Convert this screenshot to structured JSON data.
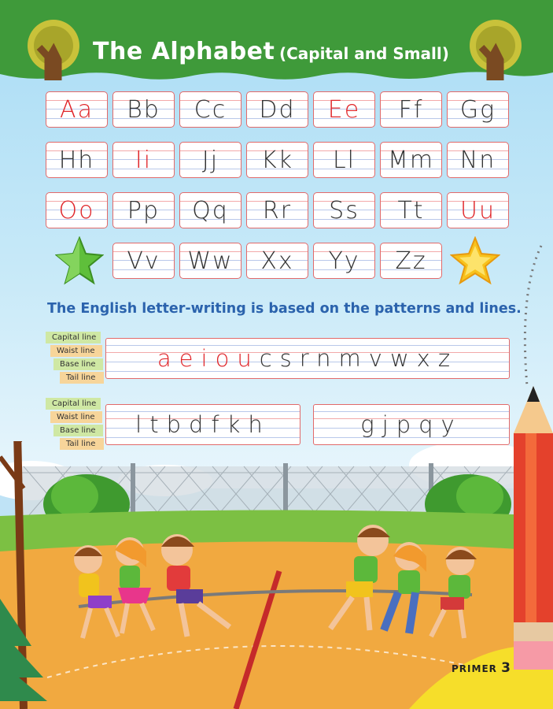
{
  "header": {
    "title": "The Alphabet",
    "subtitle": "(Capital and Small)"
  },
  "alphabet": [
    {
      "pair": "Aa",
      "vowel": true
    },
    {
      "pair": "Bb",
      "vowel": false
    },
    {
      "pair": "Cc",
      "vowel": false
    },
    {
      "pair": "Dd",
      "vowel": false
    },
    {
      "pair": "Ee",
      "vowel": true
    },
    {
      "pair": "Ff",
      "vowel": false
    },
    {
      "pair": "Gg",
      "vowel": false
    },
    {
      "pair": "Hh",
      "vowel": false
    },
    {
      "pair": "Ii",
      "vowel": true
    },
    {
      "pair": "Jj",
      "vowel": false
    },
    {
      "pair": "Kk",
      "vowel": false
    },
    {
      "pair": "Ll",
      "vowel": false
    },
    {
      "pair": "Mm",
      "vowel": false
    },
    {
      "pair": "Nn",
      "vowel": false
    },
    {
      "pair": "Oo",
      "vowel": true
    },
    {
      "pair": "Pp",
      "vowel": false
    },
    {
      "pair": "Qq",
      "vowel": false
    },
    {
      "pair": "Rr",
      "vowel": false
    },
    {
      "pair": "Ss",
      "vowel": false
    },
    {
      "pair": "Tt",
      "vowel": false
    },
    {
      "pair": "Uu",
      "vowel": true
    },
    {
      "pair": "Vv",
      "vowel": false
    },
    {
      "pair": "Ww",
      "vowel": false
    },
    {
      "pair": "Xx",
      "vowel": false
    },
    {
      "pair": "Yy",
      "vowel": false
    },
    {
      "pair": "Zz",
      "vowel": false
    }
  ],
  "note": "The English letter-writing is based on the patterns and lines.",
  "guide_labels": [
    "Capital line",
    "Waist line",
    "Base line",
    "Tail line"
  ],
  "practice": {
    "row1_vowels": "aeiou",
    "row1_rest": "csrnmvwxz",
    "row2_tall": "ltbdfkh",
    "row2_tail": "gjpqy"
  },
  "footer": {
    "book": "PRIMER",
    "page_number": "3"
  },
  "colors": {
    "banner_green": "#3f9a3a",
    "vowel_red": "#e0262a",
    "note_blue": "#2b63ad"
  }
}
